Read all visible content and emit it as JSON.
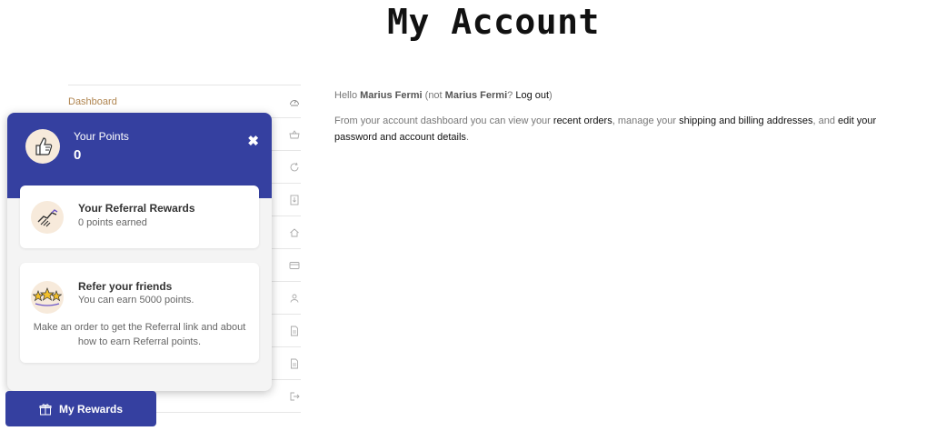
{
  "page": {
    "title": "My Account"
  },
  "nav": {
    "items": [
      {
        "label": "Dashboard",
        "icon": "dashboard-icon",
        "active": true
      },
      {
        "label": "",
        "icon": "basket-icon"
      },
      {
        "label": "",
        "icon": "refresh-icon"
      },
      {
        "label": "",
        "icon": "download-icon"
      },
      {
        "label": "",
        "icon": "home-icon"
      },
      {
        "label": "",
        "icon": "credit-card-icon"
      },
      {
        "label": "",
        "icon": "user-icon"
      },
      {
        "label": "",
        "icon": "document-icon"
      },
      {
        "label": "",
        "icon": "document-icon"
      },
      {
        "label": "",
        "icon": "logout-icon"
      }
    ]
  },
  "main": {
    "greeting_prefix": "Hello ",
    "user_name": "Marius Fermi",
    "greeting_mid": " (not ",
    "user_name_2": "Marius Fermi",
    "greeting_q": "? ",
    "logout_label": "Log out",
    "greeting_end": ")",
    "desc_1": "From your account dashboard you can view your ",
    "recent_orders_link": "recent orders",
    "desc_2": ", manage your ",
    "addresses_link": "shipping and billing addresses",
    "desc_3": ", and ",
    "account_link": "edit your password and account details",
    "desc_4": "."
  },
  "rewards": {
    "header_title": "Your Points",
    "points": "0",
    "referral_title": "Your Referral Rewards",
    "referral_sub": "0 points earned",
    "refer_title": "Refer your friends",
    "refer_sub": "You can earn 5000 points.",
    "refer_note": "Make an order to get the Referral link and about how to earn Referral points.",
    "button_label": "My Rewards"
  },
  "colors": {
    "brand": "#3540a0",
    "accent": "#b08550",
    "icon_bg": "#f7eadb"
  }
}
